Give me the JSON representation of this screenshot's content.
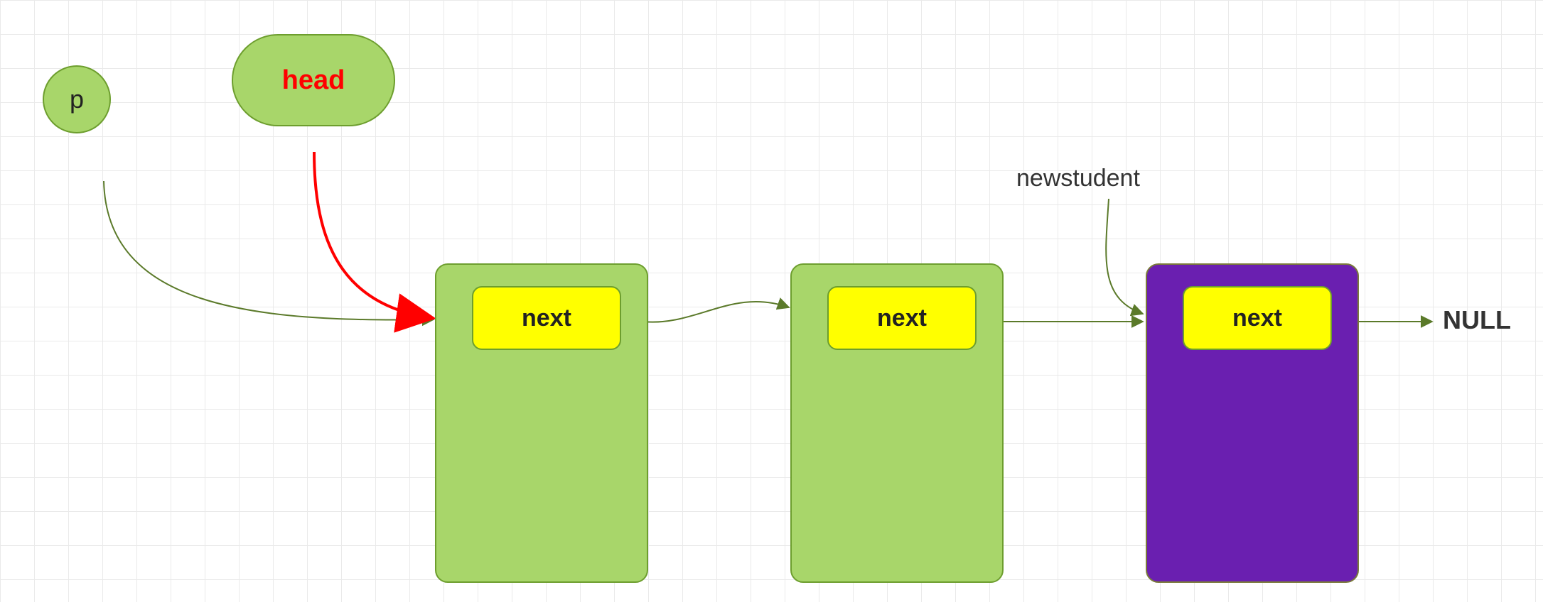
{
  "pointers": {
    "p": "p",
    "head": "head",
    "newstudent": "newstudent"
  },
  "nodes": {
    "node1": {
      "next_label": "next",
      "color": "green"
    },
    "node2": {
      "next_label": "next",
      "color": "green"
    },
    "node3": {
      "next_label": "next",
      "color": "purple"
    }
  },
  "terminal": "NULL",
  "colors": {
    "node_green_fill": "#a8d66a",
    "node_green_border": "#6d9e2e",
    "node_purple_fill": "#6a1fb0",
    "next_fill": "#ffff00",
    "head_text": "#ff0000",
    "arrow_red": "#ff0000",
    "arrow_olive": "#5b7a2a"
  }
}
